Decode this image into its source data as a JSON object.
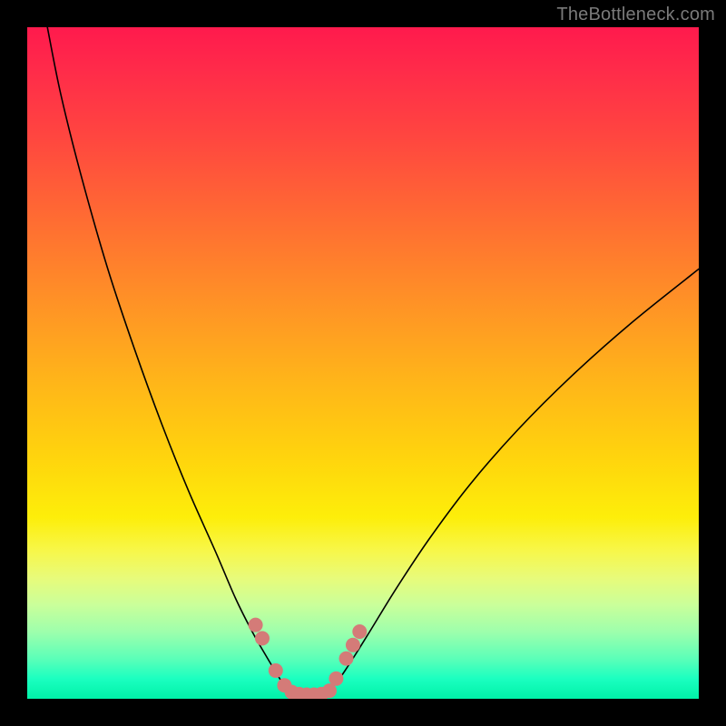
{
  "watermark": "TheBottleneck.com",
  "chart_data": {
    "type": "line",
    "title": "",
    "xlabel": "",
    "ylabel": "",
    "xlim": [
      0,
      100
    ],
    "ylim": [
      0,
      100
    ],
    "series": [
      {
        "name": "left-curve",
        "x": [
          3,
          5,
          8,
          12,
          16,
          20,
          24,
          28,
          31,
          33.5,
          35.5,
          37,
          38,
          39,
          40
        ],
        "y": [
          100,
          90,
          78,
          64,
          52,
          41,
          31,
          22,
          15,
          10,
          6.5,
          4,
          2.4,
          1.3,
          0.8
        ]
      },
      {
        "name": "right-curve",
        "x": [
          44,
          45,
          46.5,
          48.5,
          51,
          55,
          60,
          66,
          73,
          81,
          90,
          100
        ],
        "y": [
          0.8,
          1.3,
          3,
          6,
          10,
          16.5,
          24,
          32,
          40,
          48,
          56,
          64
        ]
      },
      {
        "name": "valley-floor",
        "x": [
          40,
          41,
          42,
          43,
          44
        ],
        "y": [
          0.8,
          0.6,
          0.55,
          0.6,
          0.8
        ]
      }
    ],
    "markers": {
      "color": "#d47b78",
      "radius_px": 8,
      "points": [
        {
          "x": 34,
          "y": 11
        },
        {
          "x": 35,
          "y": 9
        },
        {
          "x": 37,
          "y": 4.2
        },
        {
          "x": 38.3,
          "y": 2.0
        },
        {
          "x": 39.4,
          "y": 1.0
        },
        {
          "x": 40.5,
          "y": 0.7
        },
        {
          "x": 41.6,
          "y": 0.6
        },
        {
          "x": 42.7,
          "y": 0.6
        },
        {
          "x": 43.8,
          "y": 0.7
        },
        {
          "x": 45.0,
          "y": 1.2
        },
        {
          "x": 46.0,
          "y": 3.0
        },
        {
          "x": 47.5,
          "y": 6.0
        },
        {
          "x": 48.5,
          "y": 8.0
        },
        {
          "x": 49.5,
          "y": 10.0
        }
      ]
    }
  }
}
